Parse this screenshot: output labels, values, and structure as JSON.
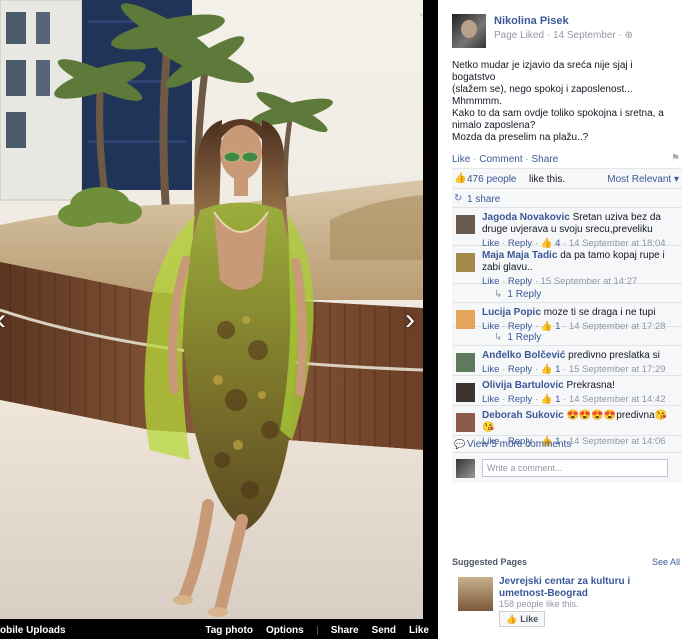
{
  "photo_bar": {
    "album": "obile Uploads",
    "actions": [
      "Tag photo",
      "Options",
      "Share",
      "Send",
      "Like"
    ]
  },
  "post": {
    "author": "Nikolina Pisek",
    "meta_type": "Page Liked",
    "meta_date": "14 September",
    "text_lines": [
      "Netko mudar je izjavio da sreća nije sjaj i bogatstvo",
      "(slažem se), nego spokoj i zaposlenost...",
      "Mhmmmm.",
      "Kako to da sam ovdje toliko spokojna i sretna, a",
      "nimalo zaposlena?",
      "Mozda da preselim na plažu..?"
    ],
    "actions": {
      "like": "Like",
      "comment": "Comment",
      "share": "Share"
    }
  },
  "ufi": {
    "likes_count": "476 people",
    "likes_suffix": "like this.",
    "sort": "Most Relevant ▾",
    "shares": "1 share",
    "comments": [
      {
        "author": "Jagoda Novakovic",
        "text": "Sretan uziva bez da druge uvjerava u svoju srecu,preveliku",
        "likes": "4",
        "time": "14 September at 18:04",
        "avatar_color": "#6b5a4e"
      },
      {
        "author": "Maja Maja Tadic",
        "text": "da pa tamo kopaj rupe i zabi glavu..",
        "likes": "",
        "time": "15 September at 14:27",
        "avatar_color": "#a48a4c",
        "reply": "1 Reply"
      },
      {
        "author": "Lucija Popic",
        "text": "moze ti se draga i ne tupi",
        "likes": "1",
        "time": "14 September at 17:28",
        "avatar_color": "#e6a35a",
        "reply": "1 Reply"
      },
      {
        "author": "Anđelko Bolčević",
        "text": "predivno preslatka si",
        "likes": "1",
        "time": "15 September at 17:29",
        "avatar_color": "#5f7a5c"
      },
      {
        "author": "Olivija Bartulovic",
        "text": "Prekrasna!",
        "likes": "1",
        "time": "14 September at 14:42",
        "avatar_color": "#3a3330"
      },
      {
        "author": "Deborah Sukovic",
        "text": "😍😍😍😍predivna😘😘",
        "likes": "1",
        "time": "14 September at 14:06",
        "avatar_color": "#8c5a4a"
      }
    ],
    "reply_label": "Reply",
    "like_label": "Like",
    "more_comments": "View 5 more comments",
    "write_placeholder": "Write a comment..."
  },
  "suggested": {
    "title": "Suggested Pages",
    "see_all": "See All",
    "page_name": "Jevrejski centar za kulturu i umetnost-Beograd",
    "page_likes": "158 people like this.",
    "like_button": "Like"
  },
  "colors": {
    "link": "#3b5998",
    "meta": "#9197a3",
    "ufi_bg": "#f6f7f9"
  }
}
